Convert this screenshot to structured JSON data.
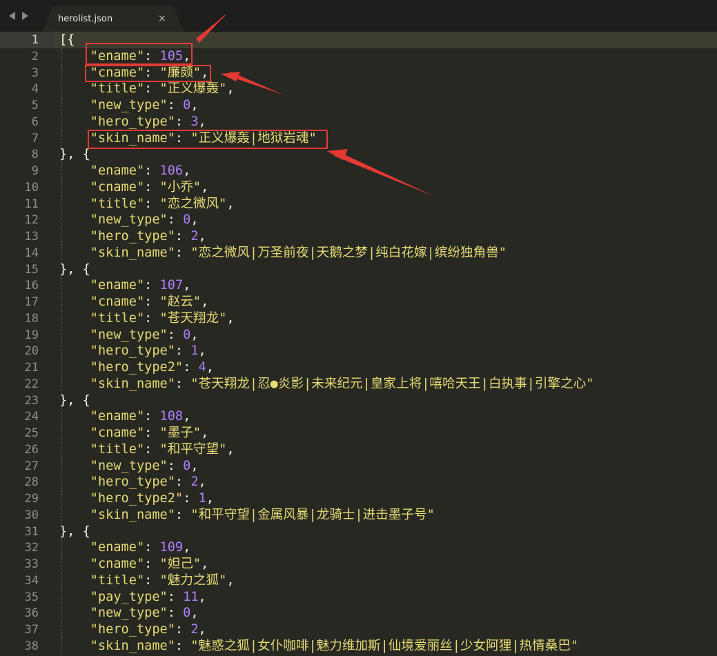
{
  "window": {
    "tab": {
      "title": "herolist.json",
      "close_glyph": "×"
    },
    "nav": {
      "back_icon": "triangle-left-icon",
      "forward_icon": "triangle-right-icon"
    }
  },
  "colors": {
    "background": "#272822",
    "key_string": "#e6db74",
    "number": "#ae81ff",
    "punctuation": "#f8f8f2",
    "annotation": "#e53935"
  },
  "editor": {
    "current_line": 1,
    "lines": [
      {
        "n": "1",
        "tokens": [
          {
            "t": "p",
            "v": "[{"
          }
        ]
      },
      {
        "n": "2",
        "tokens": [
          {
            "t": "p",
            "v": "    "
          },
          {
            "t": "k",
            "v": "\"ename\""
          },
          {
            "t": "p",
            "v": ": "
          },
          {
            "t": "n",
            "v": "105"
          },
          {
            "t": "p",
            "v": ","
          }
        ]
      },
      {
        "n": "3",
        "tokens": [
          {
            "t": "p",
            "v": "    "
          },
          {
            "t": "k",
            "v": "\"cname\""
          },
          {
            "t": "p",
            "v": ": "
          },
          {
            "t": "s",
            "v": "\"廉颇\""
          },
          {
            "t": "p",
            "v": ","
          }
        ]
      },
      {
        "n": "4",
        "tokens": [
          {
            "t": "p",
            "v": "    "
          },
          {
            "t": "k",
            "v": "\"title\""
          },
          {
            "t": "p",
            "v": ": "
          },
          {
            "t": "s",
            "v": "\"正义爆轰\""
          },
          {
            "t": "p",
            "v": ","
          }
        ]
      },
      {
        "n": "5",
        "tokens": [
          {
            "t": "p",
            "v": "    "
          },
          {
            "t": "k",
            "v": "\"new_type\""
          },
          {
            "t": "p",
            "v": ": "
          },
          {
            "t": "n",
            "v": "0"
          },
          {
            "t": "p",
            "v": ","
          }
        ]
      },
      {
        "n": "6",
        "tokens": [
          {
            "t": "p",
            "v": "    "
          },
          {
            "t": "k",
            "v": "\"hero_type\""
          },
          {
            "t": "p",
            "v": ": "
          },
          {
            "t": "n",
            "v": "3"
          },
          {
            "t": "p",
            "v": ","
          }
        ]
      },
      {
        "n": "7",
        "tokens": [
          {
            "t": "p",
            "v": "    "
          },
          {
            "t": "k",
            "v": "\"skin_name\""
          },
          {
            "t": "p",
            "v": ": "
          },
          {
            "t": "s",
            "v": "\"正义爆轰|地狱岩魂\""
          }
        ]
      },
      {
        "n": "8",
        "tokens": [
          {
            "t": "p",
            "v": "}, {"
          }
        ]
      },
      {
        "n": "9",
        "tokens": [
          {
            "t": "p",
            "v": "    "
          },
          {
            "t": "k",
            "v": "\"ename\""
          },
          {
            "t": "p",
            "v": ": "
          },
          {
            "t": "n",
            "v": "106"
          },
          {
            "t": "p",
            "v": ","
          }
        ]
      },
      {
        "n": "10",
        "tokens": [
          {
            "t": "p",
            "v": "    "
          },
          {
            "t": "k",
            "v": "\"cname\""
          },
          {
            "t": "p",
            "v": ": "
          },
          {
            "t": "s",
            "v": "\"小乔\""
          },
          {
            "t": "p",
            "v": ","
          }
        ]
      },
      {
        "n": "11",
        "tokens": [
          {
            "t": "p",
            "v": "    "
          },
          {
            "t": "k",
            "v": "\"title\""
          },
          {
            "t": "p",
            "v": ": "
          },
          {
            "t": "s",
            "v": "\"恋之微风\""
          },
          {
            "t": "p",
            "v": ","
          }
        ]
      },
      {
        "n": "12",
        "tokens": [
          {
            "t": "p",
            "v": "    "
          },
          {
            "t": "k",
            "v": "\"new_type\""
          },
          {
            "t": "p",
            "v": ": "
          },
          {
            "t": "n",
            "v": "0"
          },
          {
            "t": "p",
            "v": ","
          }
        ]
      },
      {
        "n": "13",
        "tokens": [
          {
            "t": "p",
            "v": "    "
          },
          {
            "t": "k",
            "v": "\"hero_type\""
          },
          {
            "t": "p",
            "v": ": "
          },
          {
            "t": "n",
            "v": "2"
          },
          {
            "t": "p",
            "v": ","
          }
        ]
      },
      {
        "n": "14",
        "tokens": [
          {
            "t": "p",
            "v": "    "
          },
          {
            "t": "k",
            "v": "\"skin_name\""
          },
          {
            "t": "p",
            "v": ": "
          },
          {
            "t": "s",
            "v": "\"恋之微风|万圣前夜|天鹅之梦|纯白花嫁|缤纷独角兽\""
          }
        ]
      },
      {
        "n": "15",
        "tokens": [
          {
            "t": "p",
            "v": "}, {"
          }
        ]
      },
      {
        "n": "16",
        "tokens": [
          {
            "t": "p",
            "v": "    "
          },
          {
            "t": "k",
            "v": "\"ename\""
          },
          {
            "t": "p",
            "v": ": "
          },
          {
            "t": "n",
            "v": "107"
          },
          {
            "t": "p",
            "v": ","
          }
        ]
      },
      {
        "n": "17",
        "tokens": [
          {
            "t": "p",
            "v": "    "
          },
          {
            "t": "k",
            "v": "\"cname\""
          },
          {
            "t": "p",
            "v": ": "
          },
          {
            "t": "s",
            "v": "\"赵云\""
          },
          {
            "t": "p",
            "v": ","
          }
        ]
      },
      {
        "n": "18",
        "tokens": [
          {
            "t": "p",
            "v": "    "
          },
          {
            "t": "k",
            "v": "\"title\""
          },
          {
            "t": "p",
            "v": ": "
          },
          {
            "t": "s",
            "v": "\"苍天翔龙\""
          },
          {
            "t": "p",
            "v": ","
          }
        ]
      },
      {
        "n": "19",
        "tokens": [
          {
            "t": "p",
            "v": "    "
          },
          {
            "t": "k",
            "v": "\"new_type\""
          },
          {
            "t": "p",
            "v": ": "
          },
          {
            "t": "n",
            "v": "0"
          },
          {
            "t": "p",
            "v": ","
          }
        ]
      },
      {
        "n": "20",
        "tokens": [
          {
            "t": "p",
            "v": "    "
          },
          {
            "t": "k",
            "v": "\"hero_type\""
          },
          {
            "t": "p",
            "v": ": "
          },
          {
            "t": "n",
            "v": "1"
          },
          {
            "t": "p",
            "v": ","
          }
        ]
      },
      {
        "n": "21",
        "tokens": [
          {
            "t": "p",
            "v": "    "
          },
          {
            "t": "k",
            "v": "\"hero_type2\""
          },
          {
            "t": "p",
            "v": ": "
          },
          {
            "t": "n",
            "v": "4"
          },
          {
            "t": "p",
            "v": ","
          }
        ]
      },
      {
        "n": "22",
        "tokens": [
          {
            "t": "p",
            "v": "    "
          },
          {
            "t": "k",
            "v": "\"skin_name\""
          },
          {
            "t": "p",
            "v": ": "
          },
          {
            "t": "s",
            "v": "\"苍天翔龙|忍●炎影|未来纪元|皇家上将|嘻哈天王|白执事|引擎之心\""
          }
        ]
      },
      {
        "n": "23",
        "tokens": [
          {
            "t": "p",
            "v": "}, {"
          }
        ]
      },
      {
        "n": "24",
        "tokens": [
          {
            "t": "p",
            "v": "    "
          },
          {
            "t": "k",
            "v": "\"ename\""
          },
          {
            "t": "p",
            "v": ": "
          },
          {
            "t": "n",
            "v": "108"
          },
          {
            "t": "p",
            "v": ","
          }
        ]
      },
      {
        "n": "25",
        "tokens": [
          {
            "t": "p",
            "v": "    "
          },
          {
            "t": "k",
            "v": "\"cname\""
          },
          {
            "t": "p",
            "v": ": "
          },
          {
            "t": "s",
            "v": "\"墨子\""
          },
          {
            "t": "p",
            "v": ","
          }
        ]
      },
      {
        "n": "26",
        "tokens": [
          {
            "t": "p",
            "v": "    "
          },
          {
            "t": "k",
            "v": "\"title\""
          },
          {
            "t": "p",
            "v": ": "
          },
          {
            "t": "s",
            "v": "\"和平守望\""
          },
          {
            "t": "p",
            "v": ","
          }
        ]
      },
      {
        "n": "27",
        "tokens": [
          {
            "t": "p",
            "v": "    "
          },
          {
            "t": "k",
            "v": "\"new_type\""
          },
          {
            "t": "p",
            "v": ": "
          },
          {
            "t": "n",
            "v": "0"
          },
          {
            "t": "p",
            "v": ","
          }
        ]
      },
      {
        "n": "28",
        "tokens": [
          {
            "t": "p",
            "v": "    "
          },
          {
            "t": "k",
            "v": "\"hero_type\""
          },
          {
            "t": "p",
            "v": ": "
          },
          {
            "t": "n",
            "v": "2"
          },
          {
            "t": "p",
            "v": ","
          }
        ]
      },
      {
        "n": "29",
        "tokens": [
          {
            "t": "p",
            "v": "    "
          },
          {
            "t": "k",
            "v": "\"hero_type2\""
          },
          {
            "t": "p",
            "v": ": "
          },
          {
            "t": "n",
            "v": "1"
          },
          {
            "t": "p",
            "v": ","
          }
        ]
      },
      {
        "n": "30",
        "tokens": [
          {
            "t": "p",
            "v": "    "
          },
          {
            "t": "k",
            "v": "\"skin_name\""
          },
          {
            "t": "p",
            "v": ": "
          },
          {
            "t": "s",
            "v": "\"和平守望|金属风暴|龙骑士|进击墨子号\""
          }
        ]
      },
      {
        "n": "31",
        "tokens": [
          {
            "t": "p",
            "v": "}, {"
          }
        ]
      },
      {
        "n": "32",
        "tokens": [
          {
            "t": "p",
            "v": "    "
          },
          {
            "t": "k",
            "v": "\"ename\""
          },
          {
            "t": "p",
            "v": ": "
          },
          {
            "t": "n",
            "v": "109"
          },
          {
            "t": "p",
            "v": ","
          }
        ]
      },
      {
        "n": "33",
        "tokens": [
          {
            "t": "p",
            "v": "    "
          },
          {
            "t": "k",
            "v": "\"cname\""
          },
          {
            "t": "p",
            "v": ": "
          },
          {
            "t": "s",
            "v": "\"妲己\""
          },
          {
            "t": "p",
            "v": ","
          }
        ]
      },
      {
        "n": "34",
        "tokens": [
          {
            "t": "p",
            "v": "    "
          },
          {
            "t": "k",
            "v": "\"title\""
          },
          {
            "t": "p",
            "v": ": "
          },
          {
            "t": "s",
            "v": "\"魅力之狐\""
          },
          {
            "t": "p",
            "v": ","
          }
        ]
      },
      {
        "n": "35",
        "tokens": [
          {
            "t": "p",
            "v": "    "
          },
          {
            "t": "k",
            "v": "\"pay_type\""
          },
          {
            "t": "p",
            "v": ": "
          },
          {
            "t": "n",
            "v": "11"
          },
          {
            "t": "p",
            "v": ","
          }
        ]
      },
      {
        "n": "36",
        "tokens": [
          {
            "t": "p",
            "v": "    "
          },
          {
            "t": "k",
            "v": "\"new_type\""
          },
          {
            "t": "p",
            "v": ": "
          },
          {
            "t": "n",
            "v": "0"
          },
          {
            "t": "p",
            "v": ","
          }
        ]
      },
      {
        "n": "37",
        "tokens": [
          {
            "t": "p",
            "v": "    "
          },
          {
            "t": "k",
            "v": "\"hero_type\""
          },
          {
            "t": "p",
            "v": ": "
          },
          {
            "t": "n",
            "v": "2"
          },
          {
            "t": "p",
            "v": ","
          }
        ]
      },
      {
        "n": "38",
        "tokens": [
          {
            "t": "p",
            "v": "    "
          },
          {
            "t": "k",
            "v": "\"skin_name\""
          },
          {
            "t": "p",
            "v": ": "
          },
          {
            "t": "s",
            "v": "\"魅惑之狐|女仆咖啡|魅力维加斯|仙境爱丽丝|少女阿狸|热情桑巴\""
          }
        ]
      }
    ]
  }
}
